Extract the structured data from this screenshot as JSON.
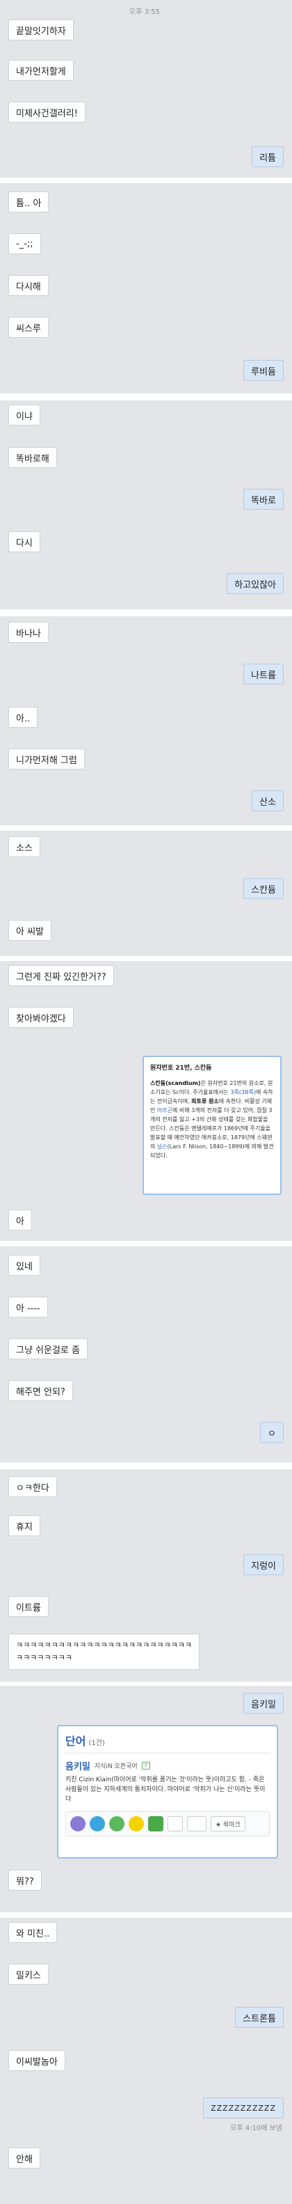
{
  "chat": {
    "time_top": "오후 3:55",
    "p1": {
      "m1": "끝말잇기하자",
      "m2": "내가먼저할게",
      "m3": "미제사건갤러리!",
      "r1": "리튬"
    },
    "p2": {
      "m1": "튬.. 아",
      "m2": "-_-;;",
      "m3": "다시해",
      "m4": "씨스루",
      "r1": "루비듐"
    },
    "p3": {
      "m1": "이냐",
      "m2": "똑바로해",
      "r1": "똑바로",
      "m3": "다시",
      "r2": "하고있잖아"
    },
    "p4": {
      "m1": "바나나",
      "r1": "나트륨",
      "m2": "아..",
      "m3": "니가먼저해 그럼",
      "r2": "산소"
    },
    "p5": {
      "m1": "소스",
      "r1": "스칸듐",
      "m2": "아 씨발"
    },
    "p6": {
      "m1": "그런게 진짜 있긴한거??",
      "m2": "찾아봐야겠다",
      "card": {
        "title": "원자번호 21번, 스칸듐",
        "b1": "스칸듐(scandium)",
        "t1": "은 원자번호 21번의 원소로, 원소기호는 Sc이다. 주기율표에서는 ",
        "l1": "3족(3B족)",
        "t2": "에 속하는 전이금속이며, ",
        "b2": "희토류 원소",
        "t3": "에 속한다. 비활성 기체인 ",
        "l2": "아르곤",
        "t4": "에 비해 3개의 전자를 더 갖고 있어, 껍질 3개의 전자를 잃고 +3의 산화 상태를 갖는 화합물을 만든다. 스칸듐은 멘델레예프가 1869년에 주기율을 발표할 때 예언하였던 에카붕소로, 1879년에 스웨덴의 ",
        "l3": "닐슨",
        "t5": "(Lars F. Nilson, 1840~1899)에 의해 발견되었다."
      },
      "m3": "아"
    },
    "p7": {
      "m1": "있네",
      "m2": "아 ----",
      "m3": "그냥 쉬운걸로 좀",
      "m4": "해주면 안되?",
      "r1": "ㅇ"
    },
    "p8": {
      "m1": "ㅇㅋ한다",
      "m2": "휴지",
      "r1": "지렁이",
      "m3": "이트륨",
      "m4": "ㅋㅋㅋㅋㅋㅋㅋㅋㅋㅋㅋㅋㅋㅋㅋㅋㅋㅋㅋㅋㅋㅋㅋㅋㅋ",
      "m5": "ㅋㅋㅋㅋㅋㅋㅋㅋ"
    },
    "p9": {
      "r1": "음키밀",
      "card": {
        "section": "단어",
        "count": "(1건)",
        "word": "음키밀",
        "source": "지식iN 오픈국어",
        "badge": "?",
        "def": "키친 Cizin Kiain(마이어로 '악취를 풍기는 것'이라는 뜻)이라고도 함. - 죽은 사람들이 있는 지하세계의 통치자이다. 마야어로 '악취가 나는 신'이라는 뜻이다",
        "more": "★ 북마크"
      },
      "m1": "뭐??"
    },
    "p10": {
      "m1": "와 미친..",
      "m2": "밀키스",
      "r1": "스트론튬",
      "m3": "이씨발놈아",
      "r2": "ZZZZZZZZZZZ",
      "time": "오후 4:10에 보냄",
      "m4": "안해"
    }
  },
  "colors": {
    "panel": "#e4e5e8",
    "incoming": "#ffffff",
    "outgoing": "#d8e6f6",
    "card_border": "#8cb4e0",
    "section_title": "#2a61b8"
  },
  "icons": [
    "talk-icon",
    "twitter-icon",
    "me2day-icon",
    "kakao-icon",
    "band-icon",
    "mail-icon",
    "share-icon"
  ]
}
